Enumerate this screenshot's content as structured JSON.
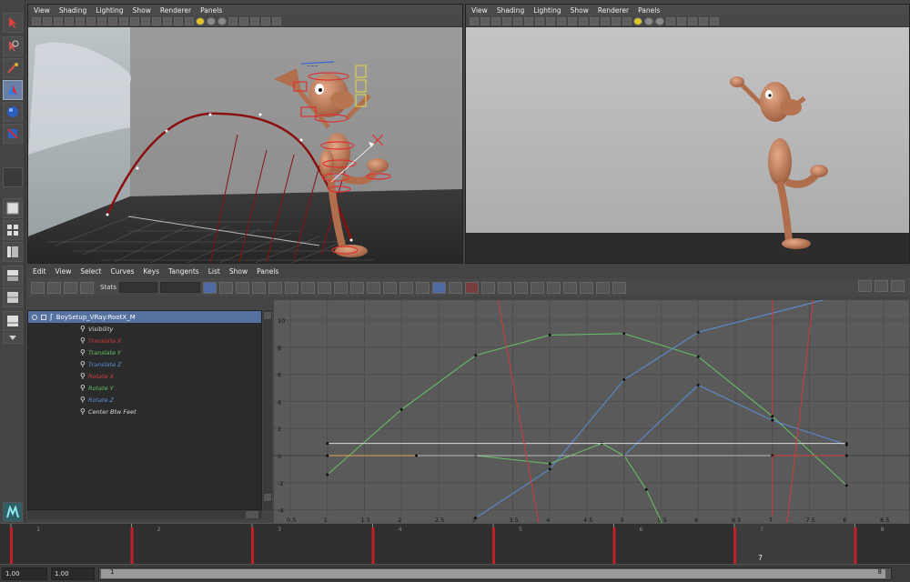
{
  "viewport_left": {
    "menu": [
      "View",
      "Shading",
      "Lighting",
      "Show",
      "Renderer",
      "Panels"
    ]
  },
  "viewport_right": {
    "menu": [
      "View",
      "Shading",
      "Lighting",
      "Show",
      "Renderer",
      "Panels"
    ]
  },
  "graph_editor": {
    "menu": [
      "Edit",
      "View",
      "Select",
      "Curves",
      "Keys",
      "Tangents",
      "List",
      "Show",
      "Panels"
    ],
    "stats_label": "Stats",
    "outliner_root": "BoySetup_VRay:RootX_M",
    "channels": [
      {
        "label": "Visibility",
        "color": "#dddddd"
      },
      {
        "label": "Translate X",
        "color": "#d33a3a"
      },
      {
        "label": "Translate Y",
        "color": "#5ec45e"
      },
      {
        "label": "Translate Z",
        "color": "#5b8fd8"
      },
      {
        "label": "Rotate X",
        "color": "#d33a3a"
      },
      {
        "label": "Rotate Y",
        "color": "#5ec45e"
      },
      {
        "label": "Rotate Z",
        "color": "#5b8fd8"
      },
      {
        "label": "Center Btw Feet",
        "color": "#dddddd"
      }
    ],
    "y_ticks": [
      "10",
      "8",
      "6",
      "4",
      "2",
      "0",
      "-2",
      "-4"
    ],
    "x_ticks": [
      "0.5",
      "1",
      "1.5",
      "2",
      "2.5",
      "3",
      "3.5",
      "4",
      "4.5",
      "5",
      "5.5",
      "6",
      "6.5",
      "7",
      "7.5",
      "8",
      "8.5"
    ]
  },
  "time_slider": {
    "frame_labels": [
      "1",
      "2",
      "3",
      "4",
      "5",
      "6",
      "7",
      "8"
    ],
    "current_frame": "7"
  },
  "range_slider": {
    "start": "1.00",
    "current": "1.00",
    "inner_start": "1",
    "inner_end": "8"
  }
}
